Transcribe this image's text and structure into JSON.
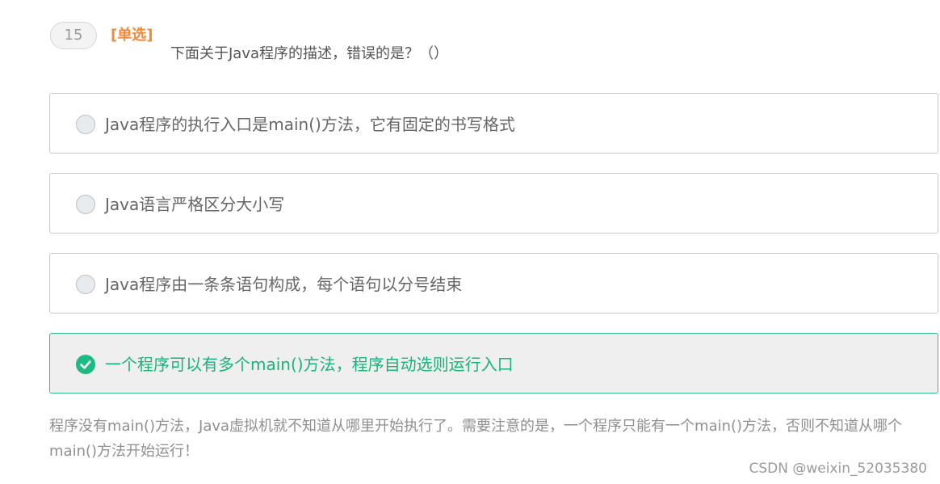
{
  "question": {
    "number": "15",
    "type_label": "[单选]",
    "text": "下面关于Java程序的描述，错误的是？（）"
  },
  "options": [
    {
      "label": "Java程序的执行入口是main()方法，它有固定的书写格式",
      "selected": false
    },
    {
      "label": "Java语言严格区分大小写",
      "selected": false
    },
    {
      "label": "Java程序由一条条语句构成，每个语句以分号结束",
      "selected": false
    },
    {
      "label": "一个程序可以有多个main()方法，程序自动选则运行入口",
      "selected": true
    }
  ],
  "explanation": "程序没有main()方法，Java虚拟机就不知道从哪里开始执行了。需要注意的是，一个程序只能有一个main()方法，否则不知道从哪个main()方法开始运行！",
  "watermark": "CSDN @weixin_52035380",
  "colors": {
    "accent_orange": "#f28a3a",
    "selected_green": "#17b37b",
    "check_green": "#1dba84",
    "selected_border": "#2fbf8c"
  },
  "icons": {
    "unselected": "radio-circle-icon",
    "selected": "check-circle-icon"
  }
}
